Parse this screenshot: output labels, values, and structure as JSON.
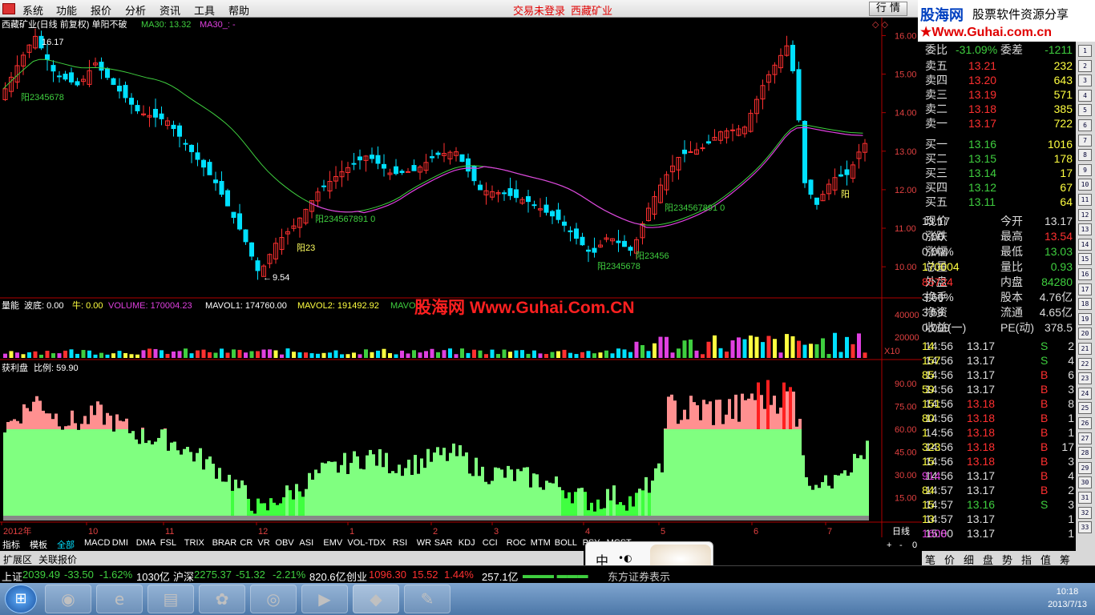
{
  "menu": {
    "items": [
      "系统",
      "功能",
      "报价",
      "分析",
      "资讯",
      "工具",
      "帮助"
    ],
    "status": "交易未登录",
    "stock": "西藏矿业",
    "quote_btn": "行 情",
    "mid_btn": "资 讯"
  },
  "brand": {
    "name": "股海网",
    "slogan": "股票软件资源分享",
    "url": "★Www.Guhai.com.cn"
  },
  "chart": {
    "title": "西藏矿业(日线 前复权) 单阳不破",
    "ma30_a": "MA30: 13.32",
    "ma30_b": "MA30_: -",
    "high_label": "16.17",
    "low_label": "9.54",
    "price_ticks": [
      "16.00",
      "15.00",
      "14.00",
      "13.00",
      "12.00",
      "11.00",
      "10.00"
    ],
    "annotations": [
      "阳2345678",
      "阳23",
      "阳234567891 0",
      "阳2345678",
      "阳23456",
      "阳234567891 0",
      "阳"
    ],
    "vol_title": "量能",
    "vol_fields": [
      "波底: 0.00",
      "牛: 0.00",
      "VOLUME: 170004.23",
      "MAVOL1: 174760.00",
      "MAVOL2: 191492.92",
      "MAVO"
    ],
    "vol_ticks": [
      "40000",
      "20000"
    ],
    "vol_unit": "X10",
    "watermark": "股海网 Www.Guhai.Com.CN",
    "profit_title": "获利盘",
    "profit_ratio": "比例: 59.90",
    "profit_ticks": [
      "90.00",
      "75.00",
      "60.00",
      "45.00",
      "30.00",
      "15.00"
    ],
    "x_labels": [
      "2012年",
      "10",
      "11",
      "12",
      "1",
      "2",
      "3",
      "4",
      "5",
      "6",
      "7"
    ],
    "period": "日线",
    "zoom_btns": [
      "+",
      "-",
      "0"
    ]
  },
  "chart_data": {
    "type": "candlestick",
    "title": "西藏矿业(日线 前复权) 单阳不破",
    "y_range": [
      9.4,
      16.3
    ],
    "series_names": [
      "MA30",
      "MA30_"
    ],
    "ma30_last": 13.32,
    "annotated_high": 16.17,
    "annotated_low": 9.54,
    "volume_last": 170004.23,
    "mavol1": 174760.0,
    "mavol2": 191492.92,
    "profit_ratio_last": 59.9
  },
  "quote": {
    "weibi_label": "委比",
    "weibi": "-31.09%",
    "weicha_label": "委差",
    "weicha": "-1211",
    "sells": [
      {
        "l": "卖五",
        "p": "13.21",
        "v": "232"
      },
      {
        "l": "卖四",
        "p": "13.20",
        "v": "643"
      },
      {
        "l": "卖三",
        "p": "13.19",
        "v": "571"
      },
      {
        "l": "卖二",
        "p": "13.18",
        "v": "385"
      },
      {
        "l": "卖一",
        "p": "13.17",
        "v": "722"
      }
    ],
    "buys": [
      {
        "l": "买一",
        "p": "13.16",
        "v": "1016"
      },
      {
        "l": "买二",
        "p": "13.15",
        "v": "178"
      },
      {
        "l": "买三",
        "p": "13.14",
        "v": "17"
      },
      {
        "l": "买四",
        "p": "13.12",
        "v": "67"
      },
      {
        "l": "买五",
        "p": "13.11",
        "v": "64"
      }
    ],
    "stats": [
      {
        "l1": "现价",
        "v1": "13.17",
        "l2": "今开",
        "v2": "13.17"
      },
      {
        "l1": "涨跌",
        "v1": "0.00",
        "l2": "最高",
        "v2": "13.54"
      },
      {
        "l1": "涨幅",
        "v1": "0.00%",
        "l2": "最低",
        "v2": "13.03"
      },
      {
        "l1": "总量",
        "v1": "170004",
        "l2": "量比",
        "v2": "0.93"
      },
      {
        "l1": "外盘",
        "v1": "85724",
        "l2": "内盘",
        "v2": "84280"
      },
      {
        "l1": "换手",
        "v1": "3.66%",
        "l2": "股本",
        "v2": "4.76亿"
      },
      {
        "l1": "净资",
        "v1": "3.59",
        "l2": "流通",
        "v2": "4.65亿"
      },
      {
        "l1": "收益(一)",
        "v1": "0.009",
        "l2": "PE(动)",
        "v2": "378.5"
      }
    ],
    "ticks": [
      {
        "t": "14:56",
        "p": "13.17",
        "v": "14",
        "s": "S",
        "n": "2"
      },
      {
        "t": "14:56",
        "p": "13.17",
        "v": "157",
        "s": "S",
        "n": "4"
      },
      {
        "t": "14:56",
        "p": "13.17",
        "v": "85",
        "s": "B",
        "n": "6"
      },
      {
        "t": "14:56",
        "p": "13.17",
        "v": "59",
        "s": "B",
        "n": "3"
      },
      {
        "t": "14:56",
        "p": "13.18",
        "v": "151",
        "s": "B",
        "n": "8"
      },
      {
        "t": "14:56",
        "p": "13.18",
        "v": "80",
        "s": "B",
        "n": "1"
      },
      {
        "t": "14:56",
        "p": "13.18",
        "v": "1",
        "s": "B",
        "n": "1"
      },
      {
        "t": "14:56",
        "p": "13.18",
        "v": "323",
        "s": "B",
        "n": "17"
      },
      {
        "t": "14:56",
        "p": "13.18",
        "v": "15",
        "s": "B",
        "n": "3"
      },
      {
        "t": "14:56",
        "p": "13.17",
        "v": "914",
        "s": "B",
        "n": "4"
      },
      {
        "t": "14:57",
        "p": "13.17",
        "v": "84",
        "s": "B",
        "n": "2"
      },
      {
        "t": "14:57",
        "p": "13.16",
        "v": "15",
        "s": "S",
        "n": "3"
      },
      {
        "t": "14:57",
        "p": "13.17",
        "v": "13",
        "s": "",
        "n": "1"
      },
      {
        "t": "15:00",
        "p": "13.17",
        "v": "1608",
        "s": "",
        "n": "1"
      }
    ]
  },
  "indicator_tabs": [
    "指标",
    "模板",
    "全部",
    "MACD",
    "DMI",
    "DMA",
    "FSL",
    "TRIX",
    "BRAR",
    "CR",
    "VR",
    "OBV",
    "ASI",
    "EMV",
    "VOL-TDX",
    "RSI",
    "WR",
    "SAR",
    "KDJ",
    "CCI",
    "ROC",
    "MTM",
    "BOLL",
    "PSY",
    "MCST"
  ],
  "sub_tabs": [
    "扩展区",
    "关联报价"
  ],
  "right_tabs": [
    "笔",
    "价",
    "细",
    "盘",
    "势",
    "指",
    "值",
    "筹"
  ],
  "tools": [
    "1",
    "2",
    "3",
    "4",
    "5",
    "6",
    "7",
    "8",
    "9",
    "10",
    "11",
    "12",
    "13",
    "14",
    "15",
    "16",
    "17",
    "18",
    "19",
    "20",
    "21",
    "22",
    "23",
    "24",
    "25",
    "26",
    "27",
    "28",
    "29",
    "30",
    "31",
    "32",
    "33",
    "34",
    "35",
    "36"
  ],
  "status": {
    "sh_label": "上证",
    "sh": "2039.49",
    "sh_chg": "-33.50",
    "sh_pct": "-1.62%",
    "sh_amt": "1030亿",
    "hs_label": "沪深",
    "hs": "2275.37",
    "hs_chg": "-51.32",
    "hs_pct": "-2.21%",
    "hs_amt": "820.6亿",
    "cy_label": "创业",
    "cy": "1096.30",
    "cy_chg": "15.52",
    "cy_pct": "1.44%",
    "cy_amt": "257.1亿",
    "news": "东方证券表示"
  },
  "ime": {
    "label": "中"
  },
  "clock": {
    "time": "10:18",
    "date": "2013/7/13"
  }
}
